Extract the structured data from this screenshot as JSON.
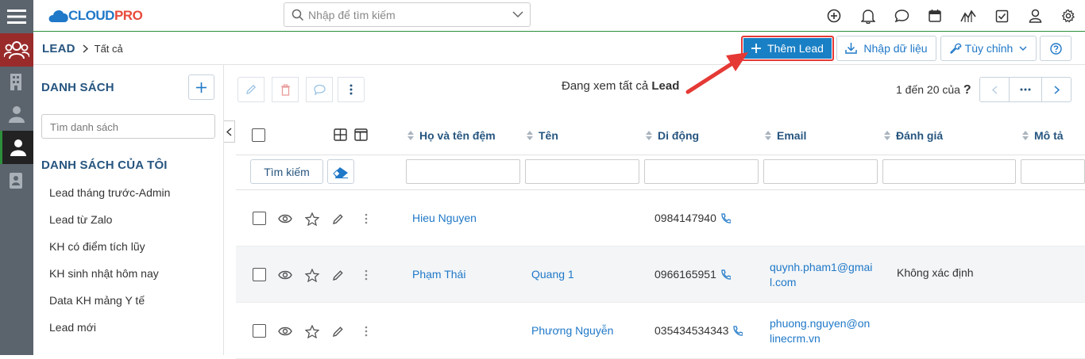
{
  "topbar": {
    "logo_main": "CLOUD",
    "logo_accent": "PRO",
    "search_placeholder": "Nhập để tìm kiếm"
  },
  "breadcrumb": {
    "module": "LEAD",
    "current": "Tất cả"
  },
  "toolbar": {
    "add_label": "Thêm Lead",
    "import_label": "Nhập dữ liệu",
    "customize_label": "Tùy chỉnh"
  },
  "sidebar": {
    "title": "DANH SÁCH",
    "search_placeholder": "Tìm danh sách",
    "my_lists_title": "DANH SÁCH CỦA TÔI",
    "items": [
      {
        "label": "Lead tháng trước-Admin"
      },
      {
        "label": "Lead từ Zalo"
      },
      {
        "label": "KH có điểm tích lũy"
      },
      {
        "label": "KH sinh nhật hôm nay"
      },
      {
        "label": "Data KH mảng Y tế"
      },
      {
        "label": "Lead mới"
      }
    ]
  },
  "list": {
    "viewing_prefix": "Đang xem tất cả",
    "viewing_module": "Lead",
    "pager_text": "1 đến 20 của",
    "pager_unknown": "?",
    "search_button": "Tìm kiếm",
    "columns": [
      {
        "label": "Họ và tên đệm"
      },
      {
        "label": "Tên"
      },
      {
        "label": "Di động"
      },
      {
        "label": "Email"
      },
      {
        "label": "Đánh giá"
      },
      {
        "label": "Mô tả"
      }
    ],
    "rows": [
      {
        "last_name": "Hieu Nguyen",
        "first_name": "",
        "mobile": "0984147940",
        "email_line1": "",
        "email_line2": "",
        "rating": ""
      },
      {
        "last_name": "Phạm Thái",
        "first_name": "Quang 1",
        "mobile": "0966165951",
        "email_line1": "quynh.pham1@gmai",
        "email_line2": "l.com",
        "rating": "Không xác định"
      },
      {
        "last_name": "",
        "first_name": "Phương Nguyễn",
        "mobile": "035434534343",
        "email_line1": "phuong.nguyen@on",
        "email_line2": "linecrm.vn",
        "rating": ""
      }
    ]
  },
  "colors": {
    "leftbar": "#5b646d",
    "active_module": "#9a2b2b",
    "primary": "#1a80c5",
    "heading": "#26557f",
    "link": "#1f78c8",
    "annotation_arrow": "#e53935"
  }
}
